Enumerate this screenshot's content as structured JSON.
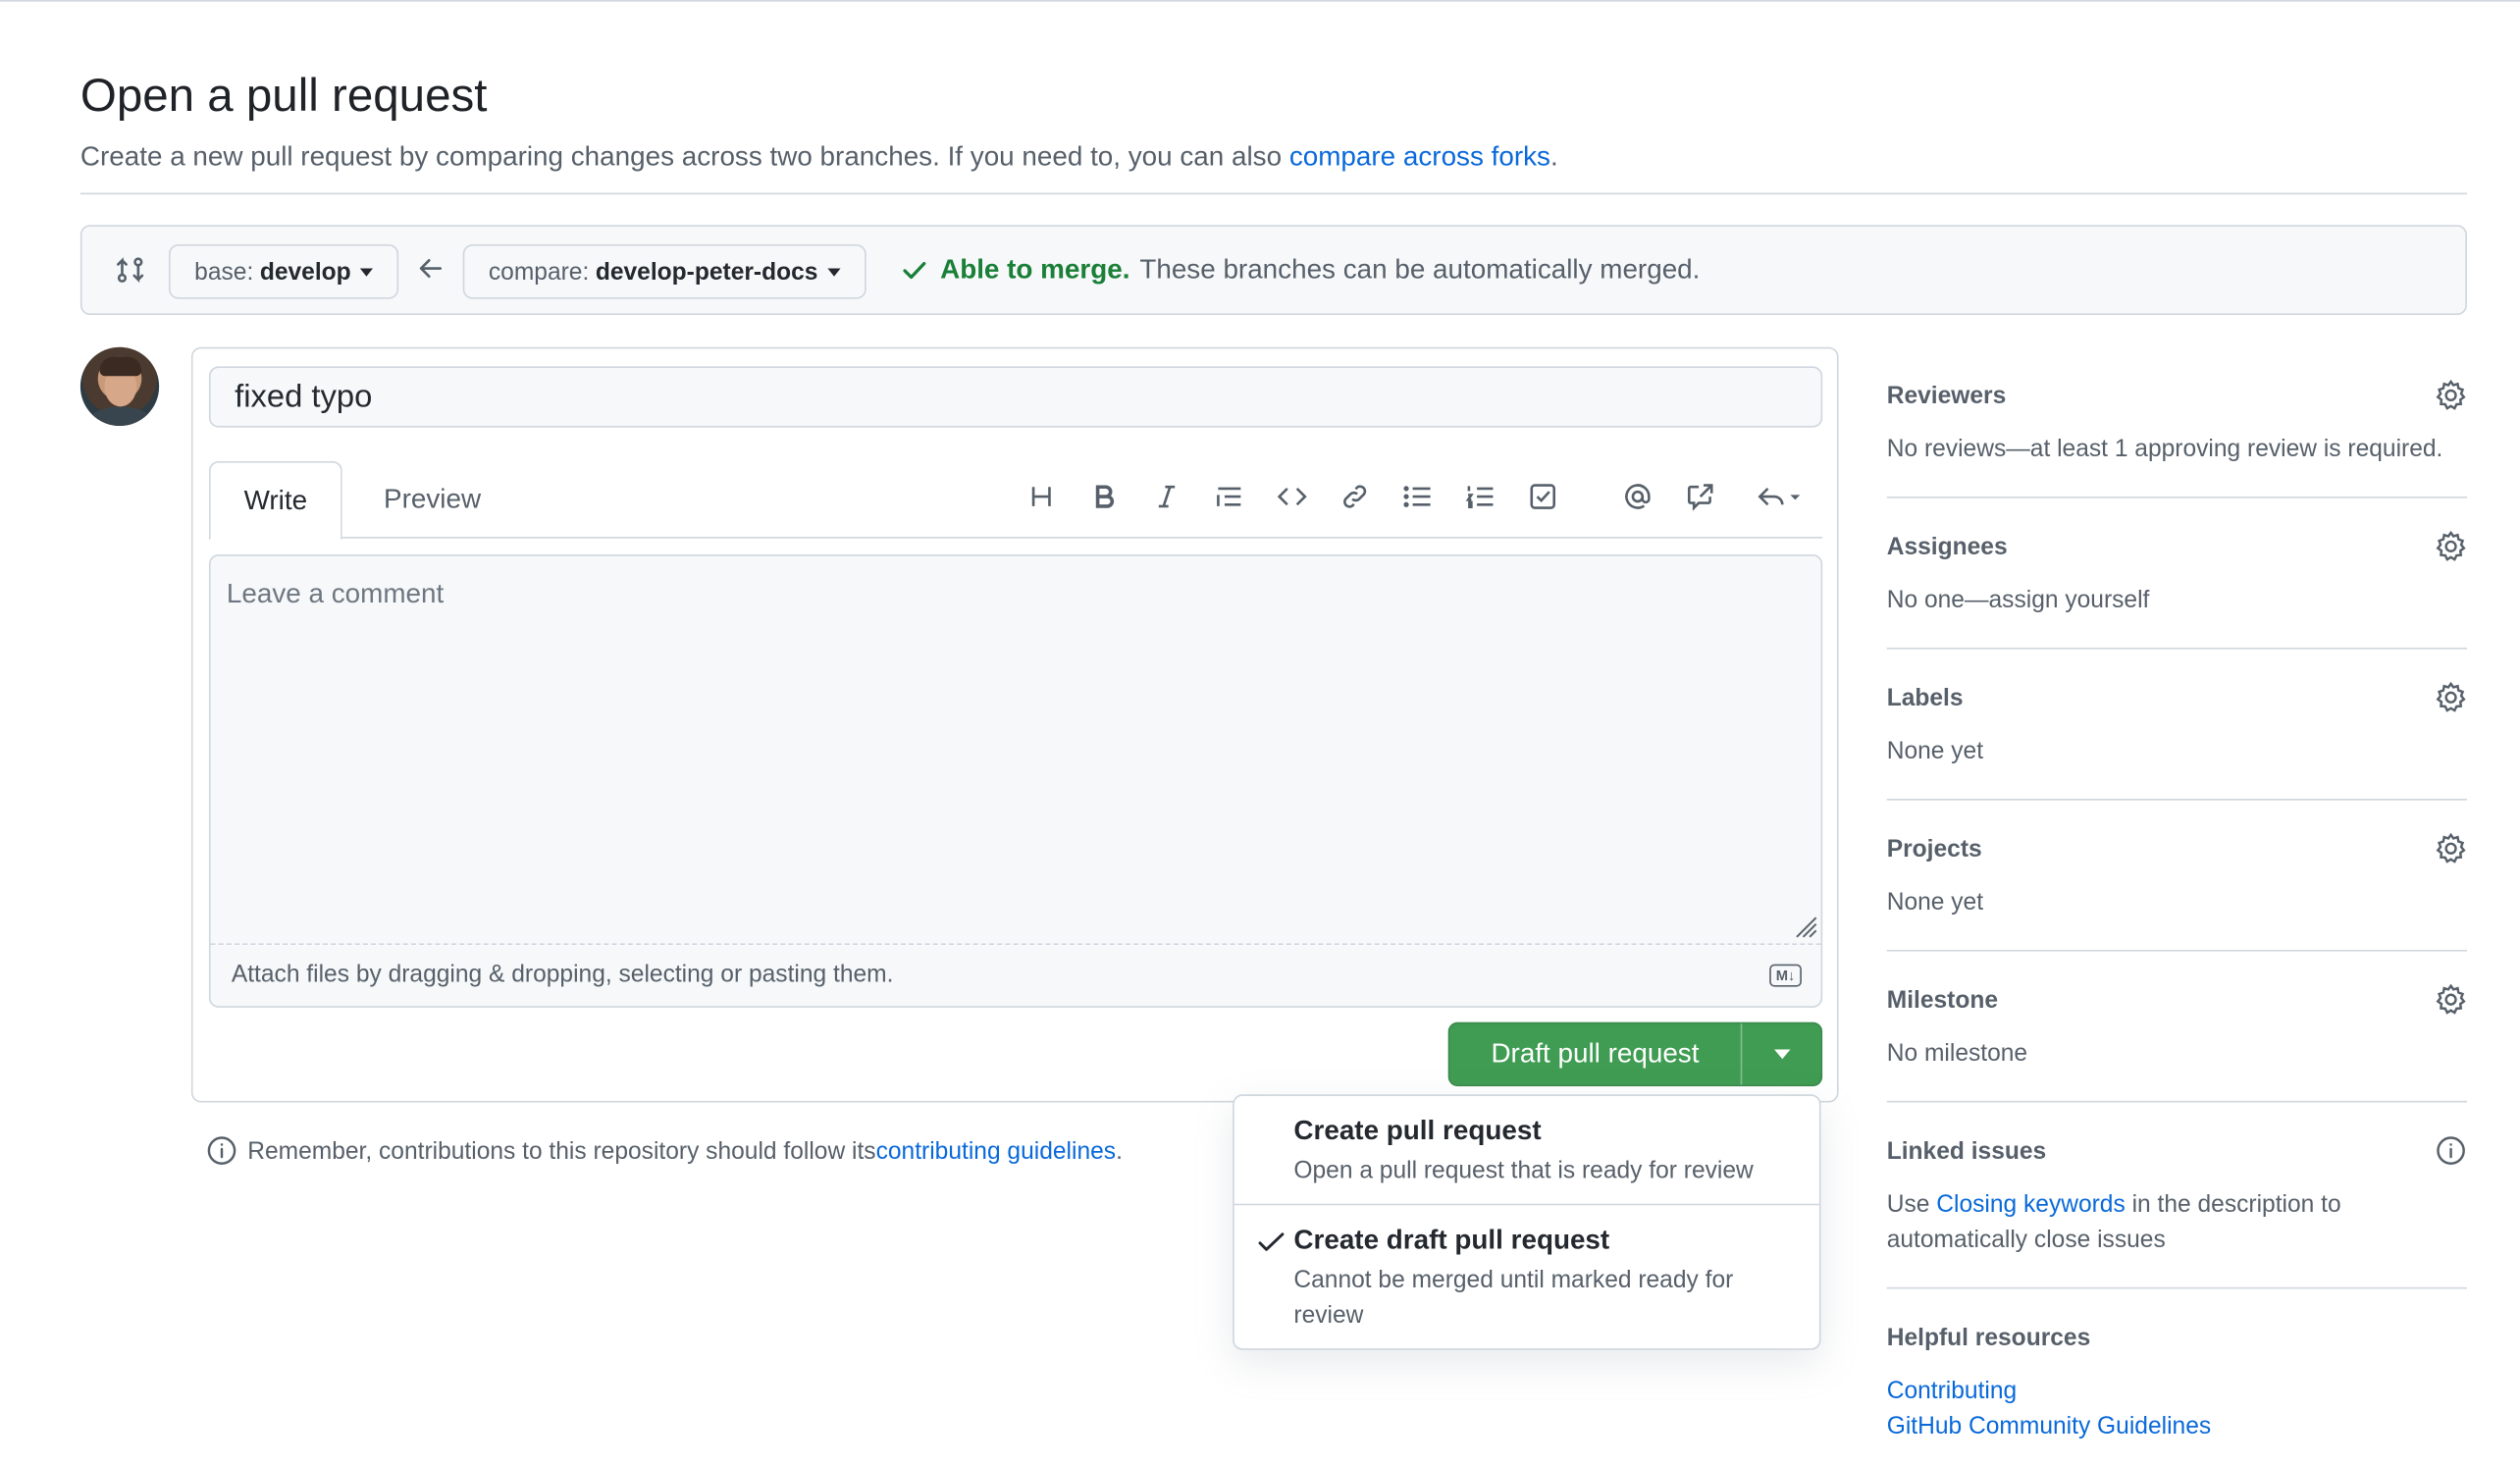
{
  "page": {
    "title": "Open a pull request",
    "subtitle_prefix": "Create a new pull request by comparing changes across two branches. If you need to, you can also ",
    "subtitle_link": "compare across forks",
    "subtitle_suffix": "."
  },
  "range": {
    "base_prefix": "base:",
    "base_branch": "develop",
    "compare_prefix": "compare:",
    "compare_branch": "develop-peter-docs",
    "merge_status": "Able to merge.",
    "merge_detail": "These branches can be automatically merged."
  },
  "composer": {
    "title_value": "fixed typo",
    "tabs": [
      "Write",
      "Preview"
    ],
    "comment_placeholder": "Leave a comment",
    "attach_hint": "Attach files by dragging & dropping, selecting or pasting them.",
    "markdown_badge": "M↓",
    "submit_label": "Draft pull request"
  },
  "menu": {
    "items": [
      {
        "title": "Create pull request",
        "desc": "Open a pull request that is ready for review",
        "selected": false
      },
      {
        "title": "Create draft pull request",
        "desc": "Cannot be merged until marked ready for review",
        "selected": true
      }
    ]
  },
  "note": {
    "prefix": "Remember, contributions to this repository should follow its ",
    "link": "contributing guidelines",
    "suffix": "."
  },
  "sidebar": {
    "reviewers": {
      "title": "Reviewers",
      "body": "No reviews—at least 1 approving review is required."
    },
    "assignees": {
      "title": "Assignees",
      "body": "No one—assign yourself"
    },
    "labels": {
      "title": "Labels",
      "body": "None yet"
    },
    "projects": {
      "title": "Projects",
      "body": "None yet"
    },
    "milestone": {
      "title": "Milestone",
      "body": "No milestone"
    },
    "linked": {
      "title": "Linked issues",
      "prefix": "Use ",
      "link": "Closing keywords",
      "suffix": " in the description to automatically close issues"
    },
    "resources": {
      "title": "Helpful resources",
      "links": [
        "Contributing",
        "GitHub Community Guidelines"
      ]
    }
  },
  "colors": {
    "accent": "#0969da",
    "success": "#1a7f37",
    "button": "#3f9c52"
  }
}
